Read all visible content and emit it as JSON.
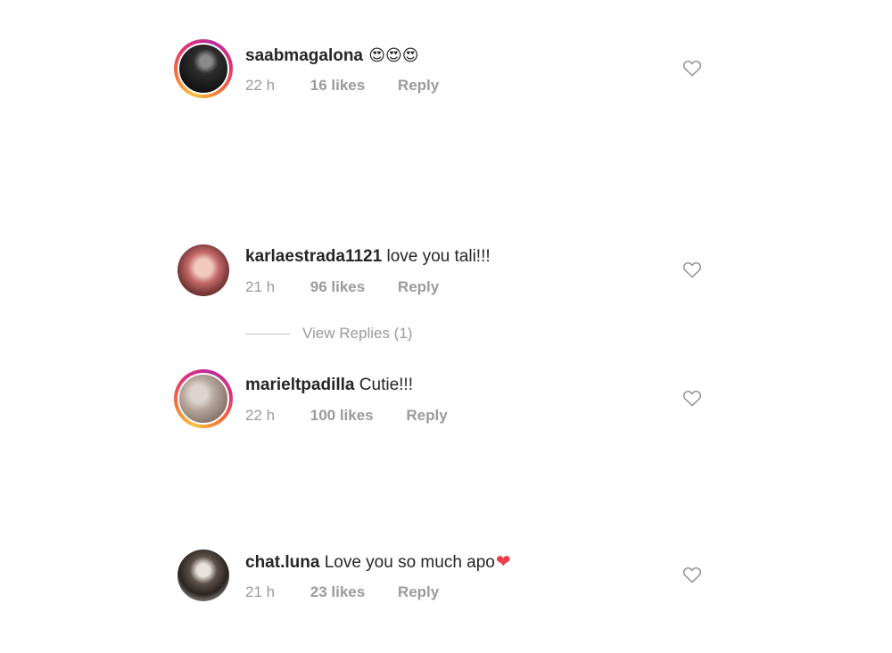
{
  "comments": [
    {
      "username": "saabmagalona",
      "text": "",
      "emoji": "😍😍😍",
      "time": "22 h",
      "likes": "16 likes",
      "reply": "Reply"
    },
    {
      "username": "karlaestrada1121",
      "text": "love you tali!!!",
      "emoji": "",
      "time": "21 h",
      "likes": "96 likes",
      "reply": "Reply"
    },
    {
      "username": "marieltpadilla",
      "text": "Cutie!!!",
      "emoji": "",
      "time": "22 h",
      "likes": "100 likes",
      "reply": "Reply"
    },
    {
      "username": "chat.luna",
      "text": "Love you so much apo",
      "emoji": "❤",
      "time": "21 h",
      "likes": "23 likes",
      "reply": "Reply"
    }
  ],
  "view_replies": "View Replies (1)",
  "icons": {
    "like": "heart-outline-icon",
    "heart_emoji": "red-heart-emoji"
  },
  "colors": {
    "text": "#262626",
    "meta": "#9b9b9b",
    "heart_red": "#ed3e4b",
    "story_ring": "#e0307a"
  }
}
